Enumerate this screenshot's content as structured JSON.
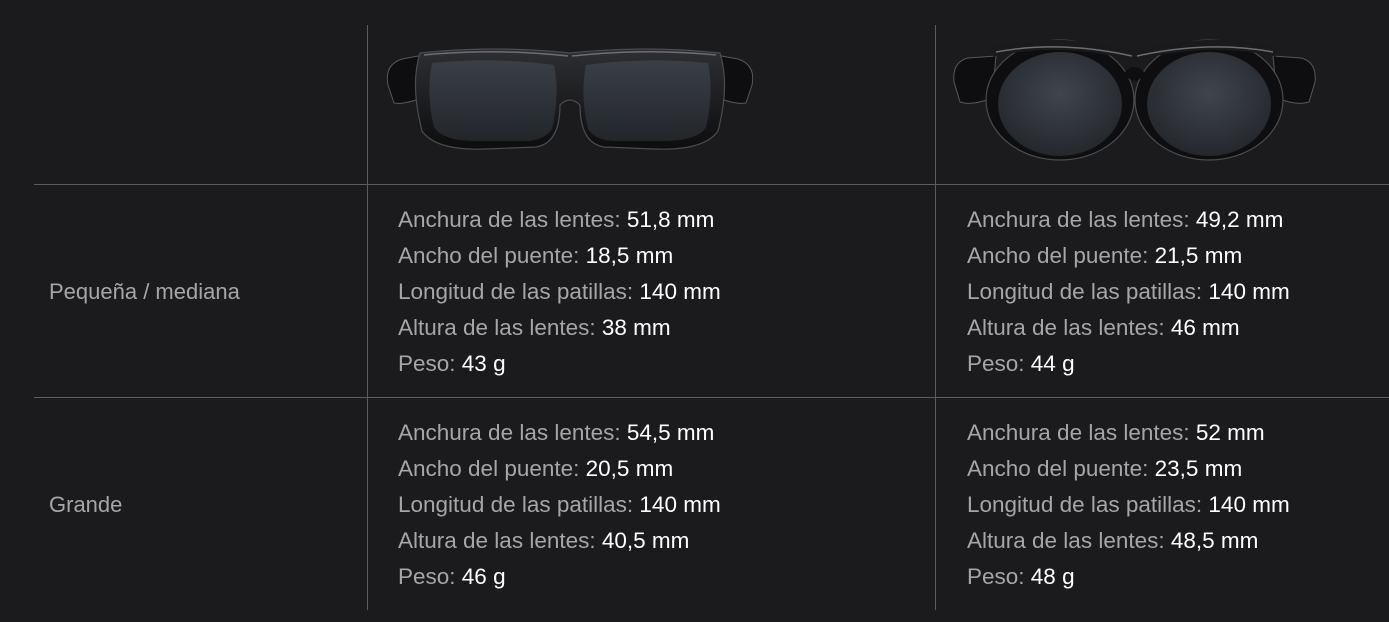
{
  "columns": [
    {
      "model_icon": "rectangular-glasses-image"
    },
    {
      "model_icon": "round-glasses-image"
    }
  ],
  "rows": [
    {
      "label": "Pequeña / mediana",
      "cells": [
        {
          "specs": [
            {
              "key": "Anchura de las lentes: ",
              "value": "51,8 mm"
            },
            {
              "key": "Ancho del puente: ",
              "value": "18,5 mm"
            },
            {
              "key": "Longitud de las patillas: ",
              "value": "140 mm"
            },
            {
              "key": "Altura de las lentes: ",
              "value": "38 mm"
            },
            {
              "key": "Peso: ",
              "value": "43 g"
            }
          ]
        },
        {
          "specs": [
            {
              "key": "Anchura de las lentes: ",
              "value": "49,2 mm"
            },
            {
              "key": "Ancho del puente: ",
              "value": "21,5 mm"
            },
            {
              "key": "Longitud de las patillas: ",
              "value": "140 mm"
            },
            {
              "key": "Altura de las lentes: ",
              "value": "46 mm"
            },
            {
              "key": "Peso: ",
              "value": "44 g"
            }
          ]
        }
      ]
    },
    {
      "label": "Grande",
      "cells": [
        {
          "specs": [
            {
              "key": "Anchura de las lentes: ",
              "value": "54,5 mm"
            },
            {
              "key": "Ancho del puente: ",
              "value": "20,5 mm"
            },
            {
              "key": "Longitud de las patillas: ",
              "value": "140 mm"
            },
            {
              "key": "Altura de las lentes: ",
              "value": "40,5 mm"
            },
            {
              "key": "Peso: ",
              "value": "46 g"
            }
          ]
        },
        {
          "specs": [
            {
              "key": "Anchura de las lentes: ",
              "value": "52 mm"
            },
            {
              "key": "Ancho del puente: ",
              "value": "23,5 mm"
            },
            {
              "key": "Longitud de las patillas: ",
              "value": "140 mm"
            },
            {
              "key": "Altura de las lentes: ",
              "value": "48,5 mm"
            },
            {
              "key": "Peso: ",
              "value": "48 g"
            }
          ]
        }
      ]
    }
  ],
  "colors": {
    "background": "#1b1b1d",
    "divider": "#5d5d60",
    "label": "#a6a6a9",
    "value": "#ffffff"
  }
}
